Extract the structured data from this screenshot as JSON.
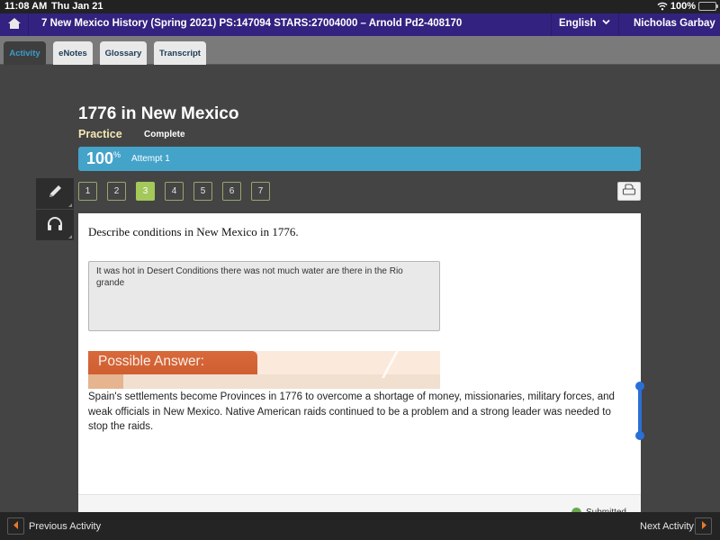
{
  "status_bar": {
    "time": "11:08 AM",
    "date": "Thu Jan 21",
    "battery": "100%"
  },
  "header": {
    "course_title": "7 New Mexico History (Spring 2021) PS:147094 STARS:27004000 – Arnold Pd2-408170",
    "language": "English",
    "user_name": "Nicholas Garbay"
  },
  "tabs": [
    {
      "label": "Activity",
      "active": true
    },
    {
      "label": "eNotes",
      "active": false
    },
    {
      "label": "Glossary",
      "active": false
    },
    {
      "label": "Transcript",
      "active": false
    }
  ],
  "activity": {
    "title": "1776 in New Mexico",
    "type": "Practice",
    "status": "Complete",
    "score": "100",
    "score_unit": "%",
    "attempt": "Attempt 1"
  },
  "pager": {
    "pages": [
      "1",
      "2",
      "3",
      "4",
      "5",
      "6",
      "7"
    ],
    "current": "3"
  },
  "question": {
    "prompt": "Describe conditions in New Mexico in 1776.",
    "student_answer": "It was hot in Desert Conditions there was not much water are there in the Rio grande",
    "possible_answer_label": "Possible Answer:",
    "possible_answer": "Spain's settlements become Provinces in 1776 to overcome a shortage of money, missionaries, military forces, and weak officials in New Mexico. Native American raids continued to be a problem and a strong leader was needed to stop the raids.",
    "submission_status": "Submitted"
  },
  "footer_nav": {
    "previous": "Previous Activity",
    "next": "Next Activity"
  },
  "colors": {
    "header_bg": "#33227f",
    "score_bar": "#44a3c9",
    "active_page": "#a4c85a",
    "banner_orange": "#d8693b",
    "nav_arrow": "#e8782a"
  }
}
